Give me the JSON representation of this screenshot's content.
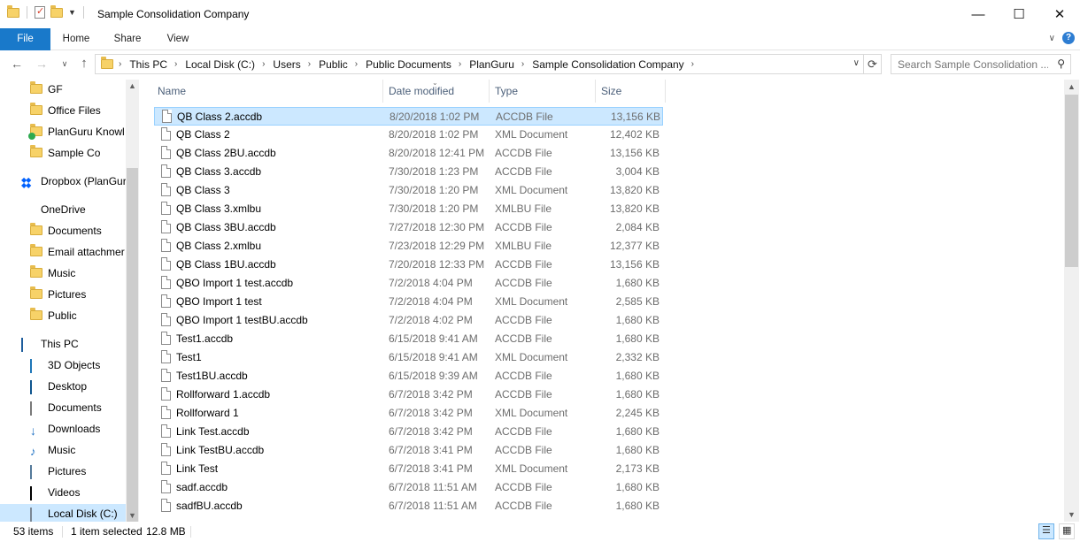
{
  "window": {
    "title": "Sample Consolidation Company",
    "minimize": "—",
    "maximize": "☐",
    "close": "✕"
  },
  "ribbon": {
    "tabs": [
      "File",
      "Home",
      "Share",
      "View"
    ],
    "expand_glyph": "∨"
  },
  "address": {
    "crumbs": [
      "This PC",
      "Local Disk (C:)",
      "Users",
      "Public",
      "Public Documents",
      "PlanGuru",
      "Sample Consolidation Company"
    ],
    "search_placeholder": "Search Sample Consolidation ..."
  },
  "nav_pane": {
    "items": [
      {
        "label": "GF",
        "icon": "folder-icon"
      },
      {
        "label": "Office Files",
        "icon": "folder-icon"
      },
      {
        "label": "PlanGuru Knowl",
        "icon": "folder-icon"
      },
      {
        "label": "Sample Co",
        "icon": "folder-icon"
      },
      {
        "label": "Dropbox (PlanGur",
        "icon": "dropbox-icon"
      },
      {
        "label": "OneDrive",
        "icon": "onedrive-icon"
      },
      {
        "label": "Documents",
        "icon": "folder-icon"
      },
      {
        "label": "Email attachmer",
        "icon": "folder-icon"
      },
      {
        "label": "Music",
        "icon": "folder-icon"
      },
      {
        "label": "Pictures",
        "icon": "folder-icon"
      },
      {
        "label": "Public",
        "icon": "folder-icon"
      },
      {
        "label": "This PC",
        "icon": "pc-icon"
      },
      {
        "label": "3D Objects",
        "icon": "3d-objects-icon"
      },
      {
        "label": "Desktop",
        "icon": "desktop-icon"
      },
      {
        "label": "Documents",
        "icon": "documents-icon"
      },
      {
        "label": "Downloads",
        "icon": "downloads-icon"
      },
      {
        "label": "Music",
        "icon": "music-icon"
      },
      {
        "label": "Pictures",
        "icon": "pictures-icon"
      },
      {
        "label": "Videos",
        "icon": "videos-icon"
      },
      {
        "label": "Local Disk (C:)",
        "icon": "disk-icon"
      }
    ]
  },
  "columns": {
    "name": "Name",
    "date": "Date modified",
    "type": "Type",
    "size": "Size"
  },
  "files": [
    {
      "name": "QB Class 2.accdb",
      "date": "8/20/2018 1:02 PM",
      "type": "ACCDB File",
      "size": "13,156 KB"
    },
    {
      "name": "QB Class 2",
      "date": "8/20/2018 1:02 PM",
      "type": "XML Document",
      "size": "12,402 KB"
    },
    {
      "name": "QB Class 2BU.accdb",
      "date": "8/20/2018 12:41 PM",
      "type": "ACCDB File",
      "size": "13,156 KB"
    },
    {
      "name": "QB Class 3.accdb",
      "date": "7/30/2018 1:23 PM",
      "type": "ACCDB File",
      "size": "3,004 KB"
    },
    {
      "name": "QB Class 3",
      "date": "7/30/2018 1:20 PM",
      "type": "XML Document",
      "size": "13,820 KB"
    },
    {
      "name": "QB Class 3.xmlbu",
      "date": "7/30/2018 1:20 PM",
      "type": "XMLBU File",
      "size": "13,820 KB"
    },
    {
      "name": "QB Class 3BU.accdb",
      "date": "7/27/2018 12:30 PM",
      "type": "ACCDB File",
      "size": "2,084 KB"
    },
    {
      "name": "QB Class 2.xmlbu",
      "date": "7/23/2018 12:29 PM",
      "type": "XMLBU File",
      "size": "12,377 KB"
    },
    {
      "name": "QB Class 1BU.accdb",
      "date": "7/20/2018 12:33 PM",
      "type": "ACCDB File",
      "size": "13,156 KB"
    },
    {
      "name": "QBO Import 1 test.accdb",
      "date": "7/2/2018 4:04 PM",
      "type": "ACCDB File",
      "size": "1,680 KB"
    },
    {
      "name": "QBO Import 1 test",
      "date": "7/2/2018 4:04 PM",
      "type": "XML Document",
      "size": "2,585 KB"
    },
    {
      "name": "QBO Import 1 testBU.accdb",
      "date": "7/2/2018 4:02 PM",
      "type": "ACCDB File",
      "size": "1,680 KB"
    },
    {
      "name": "Test1.accdb",
      "date": "6/15/2018 9:41 AM",
      "type": "ACCDB File",
      "size": "1,680 KB"
    },
    {
      "name": "Test1",
      "date": "6/15/2018 9:41 AM",
      "type": "XML Document",
      "size": "2,332 KB"
    },
    {
      "name": "Test1BU.accdb",
      "date": "6/15/2018 9:39 AM",
      "type": "ACCDB File",
      "size": "1,680 KB"
    },
    {
      "name": "Rollforward 1.accdb",
      "date": "6/7/2018 3:42 PM",
      "type": "ACCDB File",
      "size": "1,680 KB"
    },
    {
      "name": "Rollforward 1",
      "date": "6/7/2018 3:42 PM",
      "type": "XML Document",
      "size": "2,245 KB"
    },
    {
      "name": "Link Test.accdb",
      "date": "6/7/2018 3:42 PM",
      "type": "ACCDB File",
      "size": "1,680 KB"
    },
    {
      "name": "Link TestBU.accdb",
      "date": "6/7/2018 3:41 PM",
      "type": "ACCDB File",
      "size": "1,680 KB"
    },
    {
      "name": "Link Test",
      "date": "6/7/2018 3:41 PM",
      "type": "XML Document",
      "size": "2,173 KB"
    },
    {
      "name": "sadf.accdb",
      "date": "6/7/2018 11:51 AM",
      "type": "ACCDB File",
      "size": "1,680 KB"
    },
    {
      "name": "sadfBU.accdb",
      "date": "6/7/2018 11:51 AM",
      "type": "ACCDB File",
      "size": "1,680 KB"
    }
  ],
  "status": {
    "count": "53 items",
    "selected": "1 item selected",
    "selected_size": "12.8 MB"
  },
  "colors": {
    "accent": "#1979ca",
    "selection": "#cce8ff",
    "selection_border": "#99d1ff"
  }
}
